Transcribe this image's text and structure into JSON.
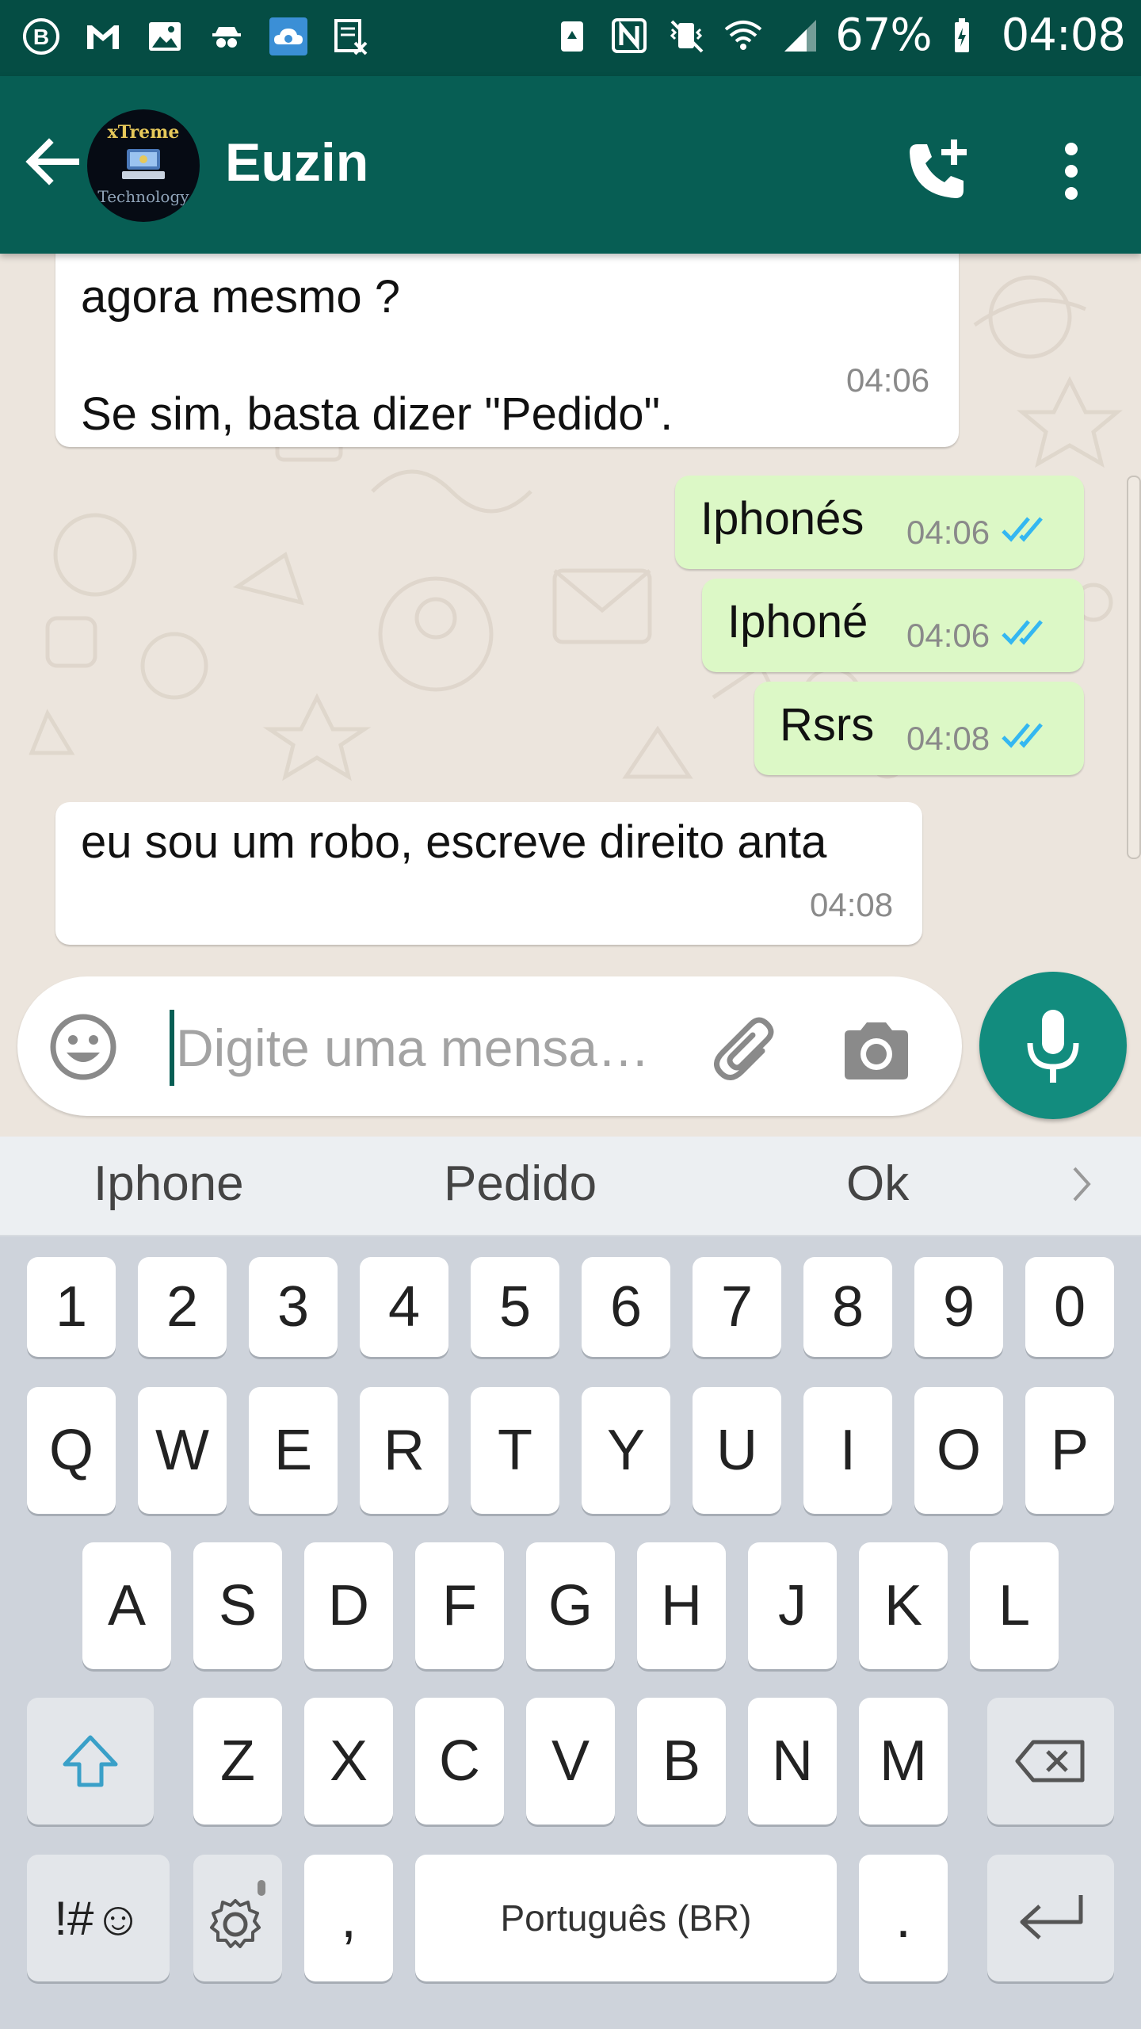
{
  "status_bar": {
    "battery": "67%",
    "time": "04:08",
    "left_icons": [
      "b-icon",
      "gmail-icon",
      "gallery-icon",
      "spy-icon",
      "cloud-icon",
      "sheet-icon"
    ],
    "right_icons": [
      "battery-saver-icon",
      "nfc-icon",
      "vibrate-icon",
      "wifi-icon",
      "signal-icon",
      "battery-icon"
    ]
  },
  "header": {
    "contact_name": "Euzin",
    "avatar_top": "xTreme",
    "avatar_bottom": "Technology"
  },
  "messages": [
    {
      "direction": "in",
      "text": "agora mesmo ?\n\nSe sim, basta dizer \"Pedido\".",
      "time": "04:06"
    },
    {
      "direction": "out",
      "text": "Iphonés",
      "time": "04:06",
      "status": "read"
    },
    {
      "direction": "out",
      "text": "Iphoné",
      "time": "04:06",
      "status": "read"
    },
    {
      "direction": "out",
      "text": "Rsrs",
      "time": "04:08",
      "status": "read"
    },
    {
      "direction": "in",
      "text": "eu sou um robo, escreve direito anta",
      "time": "04:08"
    }
  ],
  "composer": {
    "placeholder": "Digite uma mensa…"
  },
  "keyboard": {
    "suggestions": [
      "Iphone",
      "Pedido",
      "Ok"
    ],
    "row_numbers": [
      "1",
      "2",
      "3",
      "4",
      "5",
      "6",
      "7",
      "8",
      "9",
      "0"
    ],
    "row_1": [
      "Q",
      "W",
      "E",
      "R",
      "T",
      "Y",
      "U",
      "I",
      "O",
      "P"
    ],
    "row_2": [
      "A",
      "S",
      "D",
      "F",
      "G",
      "H",
      "J",
      "K",
      "L"
    ],
    "row_3": [
      "Z",
      "X",
      "C",
      "V",
      "B",
      "N",
      "M"
    ],
    "symbols_label": "!#☺",
    "comma": ",",
    "space_label": "Português (BR)",
    "period": "."
  },
  "colors": {
    "header": "#075e54",
    "status_bar": "#054d44",
    "outgoing_bubble": "#dcf8c6",
    "incoming_bubble": "#ffffff",
    "read_ticks": "#34b7f1",
    "mic_button": "#128c7e"
  }
}
